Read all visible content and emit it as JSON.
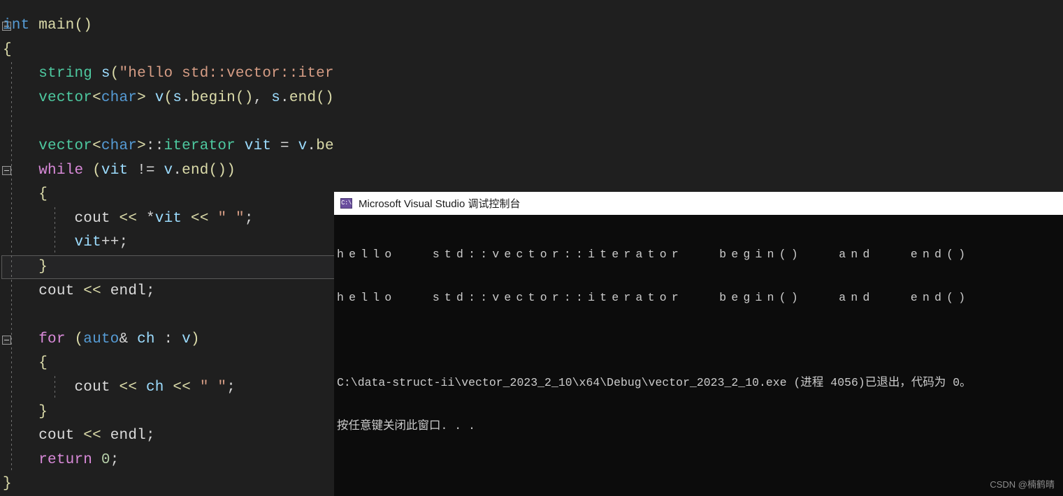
{
  "editor": {
    "name": "visual-studio-code-editor",
    "background": "#1f1f1f",
    "highlighted_line_index": 10,
    "lines": [
      {
        "indent": 0,
        "collapse": true,
        "text": "int main()"
      },
      {
        "indent": 0,
        "collapse": false,
        "text": "{"
      },
      {
        "indent": 1,
        "collapse": false,
        "text": "    string s(\"hello std::vector::iterator begin() and end()\");"
      },
      {
        "indent": 1,
        "collapse": false,
        "text": "    vector<char> v(s.begin(), s.end());"
      },
      {
        "indent": 1,
        "collapse": false,
        "text": ""
      },
      {
        "indent": 1,
        "collapse": false,
        "text": "    vector<char>::iterator vit = v.begin();"
      },
      {
        "indent": 1,
        "collapse": true,
        "text": "    while (vit != v.end())"
      },
      {
        "indent": 1,
        "collapse": false,
        "text": "    {"
      },
      {
        "indent": 2,
        "collapse": false,
        "text": "        cout << *vit << \" \";"
      },
      {
        "indent": 2,
        "collapse": false,
        "text": "        vit++;"
      },
      {
        "indent": 1,
        "collapse": false,
        "text": "    }"
      },
      {
        "indent": 1,
        "collapse": false,
        "text": "    cout << endl;"
      },
      {
        "indent": 1,
        "collapse": false,
        "text": ""
      },
      {
        "indent": 1,
        "collapse": true,
        "text": "    for (auto& ch : v)"
      },
      {
        "indent": 1,
        "collapse": false,
        "text": "    {"
      },
      {
        "indent": 2,
        "collapse": false,
        "text": "        cout << ch << \" \";"
      },
      {
        "indent": 1,
        "collapse": false,
        "text": "    }"
      },
      {
        "indent": 1,
        "collapse": false,
        "text": "    cout << endl;"
      },
      {
        "indent": 1,
        "collapse": false,
        "text": "    return 0;"
      },
      {
        "indent": 0,
        "collapse": false,
        "text": "}"
      }
    ]
  },
  "console": {
    "name": "debug-console-window",
    "title": "Microsoft Visual Studio 调试控制台",
    "icon": "console-window-icon",
    "icon_glyph": "C:\\",
    "output_line_1": "hello   std::vector::iterator   begin()   and   end()",
    "output_line_2": "hello   std::vector::iterator   begin()   and   end()",
    "exit_line": "C:\\data-struct-ii\\vector_2023_2_10\\x64\\Debug\\vector_2023_2_10.exe (进程 4056)已退出，代码为 0。",
    "prompt_line": "按任意键关闭此窗口. . ."
  },
  "watermark": {
    "text": "CSDN @楠鹤晴"
  }
}
